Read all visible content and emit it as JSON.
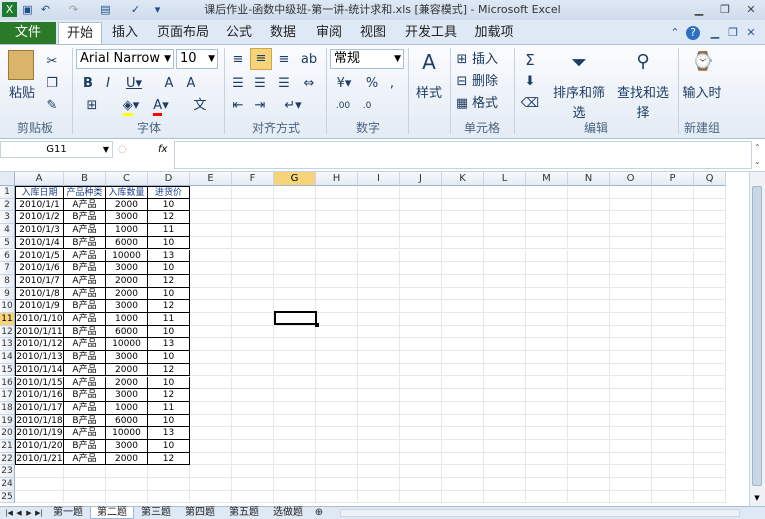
{
  "window": {
    "title": "课后作业-函数中级班-第一讲-统计求和.xls  [兼容模式]  -  Microsoft Excel"
  },
  "ribbon": {
    "file_tab": "文件",
    "tabs": [
      "开始",
      "插入",
      "页面布局",
      "公式",
      "数据",
      "审阅",
      "视图",
      "开发工具",
      "加载项"
    ],
    "font_name": "Arial Narrow",
    "font_size": "10",
    "number_format": "常规",
    "paste": "粘贴",
    "style": "样式",
    "insert": "插入",
    "delete": "删除",
    "format": "格式",
    "sort_filter": "排序和筛选",
    "find_select": "查找和选择",
    "input_time": "输入时",
    "groups": [
      "剪贴板",
      "字体",
      "对齐方式",
      "数字",
      "单元格",
      "编辑",
      "新建组"
    ]
  },
  "formula_bar": {
    "name_box": "G11",
    "fx": "fx",
    "formula": ""
  },
  "grid": {
    "columns": [
      "A",
      "B",
      "C",
      "D",
      "E",
      "F",
      "G",
      "H",
      "I",
      "J",
      "K",
      "L",
      "M",
      "N",
      "O",
      "P",
      "Q"
    ],
    "active_column": "G",
    "active_row": "11",
    "rows": [
      "1",
      "2",
      "3",
      "4",
      "5",
      "6",
      "7",
      "8",
      "9",
      "10",
      "11",
      "12",
      "13",
      "14",
      "15",
      "16",
      "17",
      "18",
      "19",
      "20",
      "21",
      "22",
      "23",
      "24",
      "25"
    ],
    "headers": [
      "入库日期",
      "产品种类",
      "入库数量",
      "进货价"
    ],
    "data": [
      [
        "2010/1/1",
        "A产品",
        "2000",
        "10"
      ],
      [
        "2010/1/2",
        "B产品",
        "3000",
        "12"
      ],
      [
        "2010/1/3",
        "A产品",
        "1000",
        "11"
      ],
      [
        "2010/1/4",
        "B产品",
        "6000",
        "10"
      ],
      [
        "2010/1/5",
        "A产品",
        "10000",
        "13"
      ],
      [
        "2010/1/6",
        "B产品",
        "3000",
        "10"
      ],
      [
        "2010/1/7",
        "A产品",
        "2000",
        "12"
      ],
      [
        "2010/1/8",
        "A产品",
        "2000",
        "10"
      ],
      [
        "2010/1/9",
        "B产品",
        "3000",
        "12"
      ],
      [
        "2010/1/10",
        "A产品",
        "1000",
        "11"
      ],
      [
        "2010/1/11",
        "B产品",
        "6000",
        "10"
      ],
      [
        "2010/1/12",
        "A产品",
        "10000",
        "13"
      ],
      [
        "2010/1/13",
        "B产品",
        "3000",
        "10"
      ],
      [
        "2010/1/14",
        "A产品",
        "2000",
        "12"
      ],
      [
        "2010/1/15",
        "A产品",
        "2000",
        "10"
      ],
      [
        "2010/1/16",
        "B产品",
        "3000",
        "12"
      ],
      [
        "2010/1/17",
        "A产品",
        "1000",
        "11"
      ],
      [
        "2010/1/18",
        "B产品",
        "6000",
        "10"
      ],
      [
        "2010/1/19",
        "A产品",
        "10000",
        "13"
      ],
      [
        "2010/1/20",
        "B产品",
        "3000",
        "10"
      ],
      [
        "2010/1/21",
        "A产品",
        "2000",
        "12"
      ]
    ]
  },
  "sheets": {
    "tabs": [
      "第一题",
      "第二题",
      "第三题",
      "第四题",
      "第五题",
      "选做题"
    ],
    "active": "第二题"
  }
}
